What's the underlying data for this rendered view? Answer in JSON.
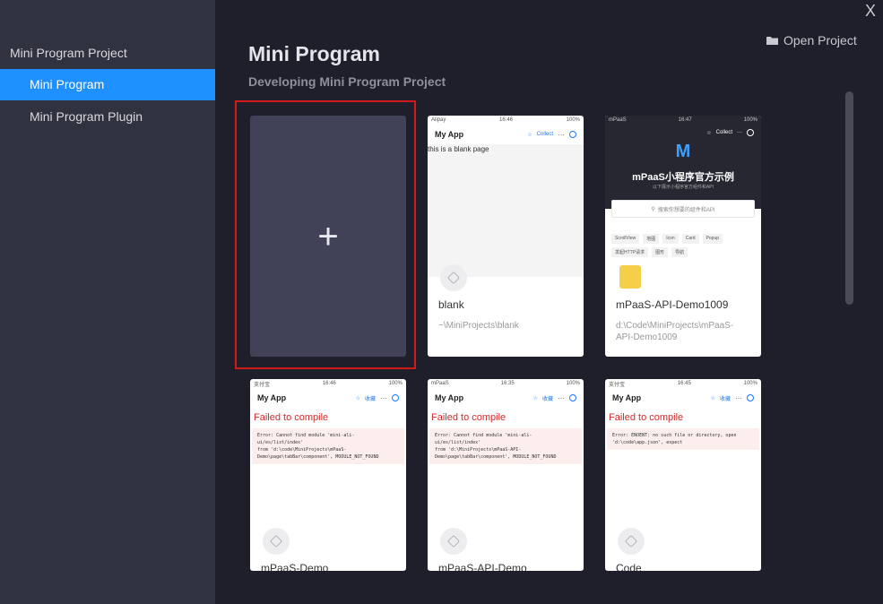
{
  "window": {
    "close_glyph": "X"
  },
  "sidebar": {
    "group_label": "Mini Program Project",
    "items": [
      {
        "label": "Mini Program",
        "active": true
      },
      {
        "label": "Mini Program Plugin",
        "active": false
      }
    ]
  },
  "header": {
    "open_project_label": "Open Project",
    "title": "Mini Program",
    "subtitle": "Developing Mini Program Project"
  },
  "new_card": {
    "plus_glyph": "+"
  },
  "projects": [
    {
      "status_left": "Alipay",
      "status_time": "16:46",
      "status_right": "100%",
      "nav_title": "My App",
      "nav_action": "Collect",
      "preview_text": "this is a blank page",
      "name": "blank",
      "path": "~\\MiniProjects\\blank"
    },
    {
      "status_left": "mPaaS",
      "status_time": "16:47",
      "status_right": "100%",
      "nav_action": "Collect",
      "hero_title": "mPaaS小程序官方示例",
      "hero_sub": "以下展示小程序官方组件和API",
      "search_placeholder": "搜索你想要的组件和API",
      "tags": [
        "ScrollView",
        "地图",
        "Icon",
        "Card",
        "Popup",
        "发起HTTP请求",
        "图形",
        "导航"
      ],
      "name": "mPaaS-API-Demo1009",
      "path": "d:\\Code\\MiniProjects\\mPaaS-API-Demo1009"
    },
    {
      "status_left": "支付宝",
      "status_time": "16:46",
      "status_right": "100%",
      "nav_title": "My App",
      "nav_action": "收藏",
      "error_title": "Failed to compile",
      "error_text": "Error: Cannot find module 'mini-ali-ui/es/list/index'\nfrom 'd:\\code\\MiniProjects\\mPaaS-\nDemo\\page\\tabBar\\component', MODULE_NOT_FOUND",
      "name": "mPaaS-Demo"
    },
    {
      "status_left": "mPaaS",
      "status_time": "16:35",
      "status_right": "100%",
      "nav_title": "My App",
      "nav_action": "收藏",
      "error_title": "Failed to compile",
      "error_text": "Error: Cannot find module 'mini-ali-ui/es/list/index'\nfrom 'd:\\MiniProjects\\mPaaS-API-\nDemo\\page\\tabBar\\component', MODULE_NOT_FOUND",
      "name": "mPaaS-API-Demo"
    },
    {
      "status_left": "支付宝",
      "status_time": "16:45",
      "status_right": "100%",
      "nav_title": "My App",
      "nav_action": "收藏",
      "error_title": "Failed to compile",
      "error_text": "Error: ENOENT: no such file or directory, open\n'd:\\code\\app.json', expect",
      "name": "Code"
    }
  ],
  "colors": {
    "accent": "#1e90ff",
    "sidebar_bg": "#31323f",
    "main_bg": "#1e1f2b",
    "error": "#d42a2a",
    "selection": "#d21a1a"
  }
}
